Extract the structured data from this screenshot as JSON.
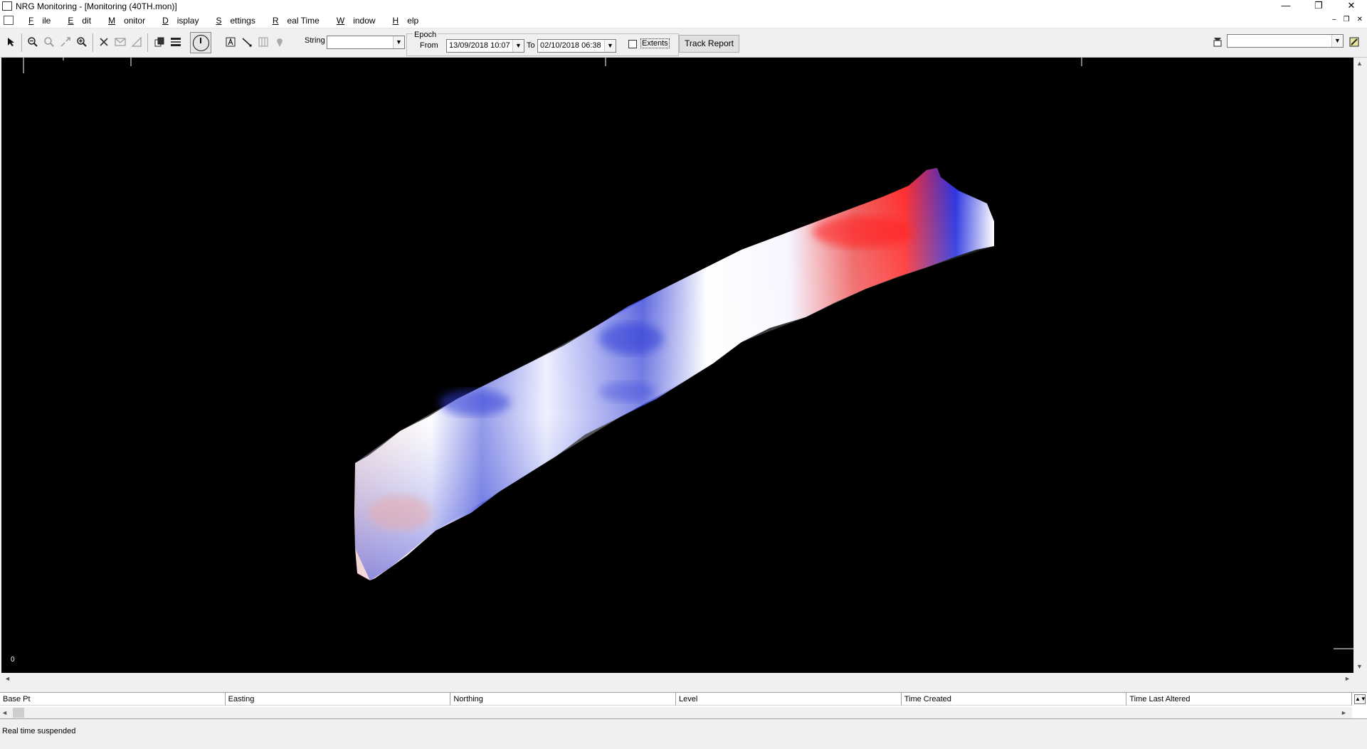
{
  "window": {
    "title": "NRG Monitoring - [Monitoring (40TH.mon)]",
    "minimize": "—",
    "restore": "❐",
    "close": "✕"
  },
  "menu": {
    "items": [
      {
        "label": "File",
        "accel": "F"
      },
      {
        "label": "Edit",
        "accel": "E"
      },
      {
        "label": "Monitor",
        "accel": "M"
      },
      {
        "label": "Display",
        "accel": "D"
      },
      {
        "label": "Settings",
        "accel": "S"
      },
      {
        "label": "Real Time",
        "accel": "R"
      },
      {
        "label": "Window",
        "accel": "W"
      },
      {
        "label": "Help",
        "accel": "H"
      }
    ],
    "mdi_minimize": "–",
    "mdi_restore": "❐",
    "mdi_close": "✕"
  },
  "toolbar": {
    "string_label": "String",
    "string_value": "",
    "epoch_label": "Epoch",
    "from_label": "From",
    "from_value": "13/09/2018 10:07",
    "to_label": "To",
    "to_value": "02/10/2018 06:38",
    "extents_label": "Extents",
    "extents_checked": false,
    "track_report_label": "Track Report",
    "right_combo_value": ""
  },
  "map": {
    "origin_label": "0",
    "background": "#000000",
    "positive_color": "#e02020",
    "negative_color": "#1f2ee0",
    "neutral_color": "#ffffff"
  },
  "grid": {
    "columns": [
      "Base Pt",
      "Easting",
      "Northing",
      "Level",
      "Time Created",
      "Time Last Altered"
    ]
  },
  "status": {
    "text": "Real time suspended"
  }
}
